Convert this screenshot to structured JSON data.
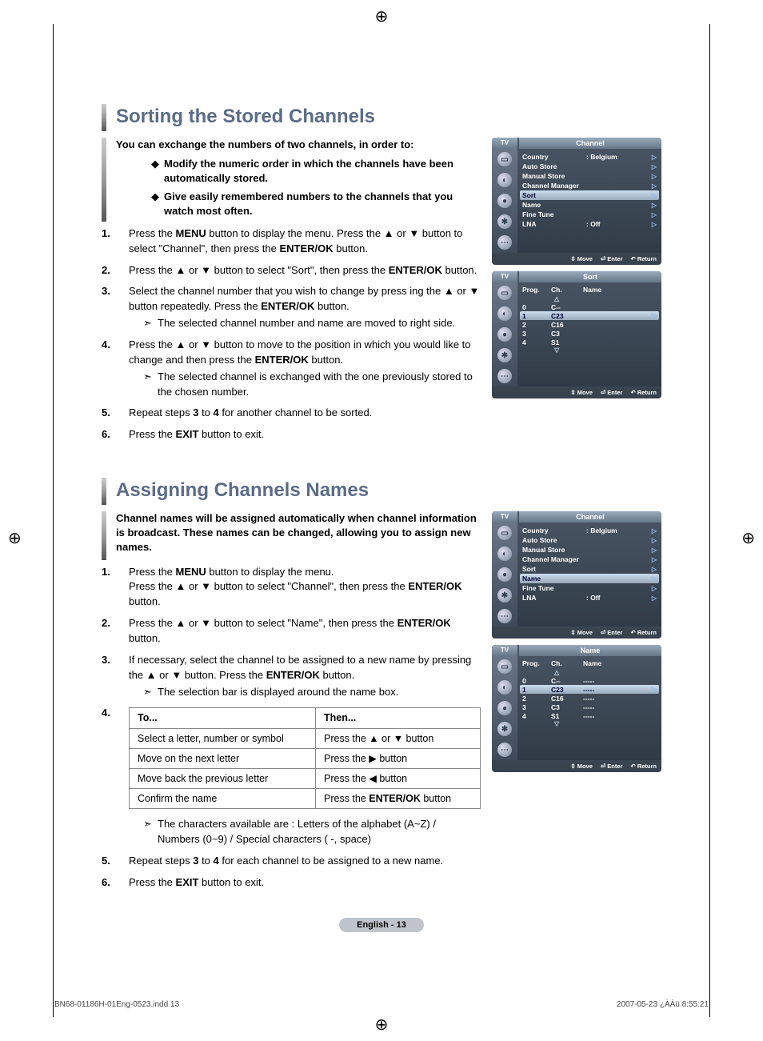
{
  "reg_glyph": "⊕",
  "section1": {
    "title": "Sorting the Stored Channels",
    "lead": "You can exchange the numbers of two channels, in order to:",
    "bullets": [
      "Modify the numeric order in which the channels have been automatically stored.",
      "Give easily remembered numbers to the channels that you watch most often."
    ],
    "steps": {
      "s1_a": "Press the ",
      "s1_menu": "MENU",
      "s1_b": " button to display the menu.  Press the ▲ or ▼ button to select \"Channel\", then press the ",
      "s1_enter": "ENTER/OK",
      "s1_c": " button.",
      "s2_a": "Press the ▲ or ▼ button to select \"Sort\", then press the ",
      "s2_enter": "ENTER/OK",
      "s2_b": " button.",
      "s3_a": "Select the channel number that you wish to change by press ing the ▲ or ▼ button repeatedly. Press the ",
      "s3_enter": "ENTER/OK",
      "s3_b": " button.",
      "s3_sub": "The selected channel number and name are moved to right side.",
      "s4_a": "Press the ▲ or ▼ button to move to the position in which you would like to change and then press the  ",
      "s4_enter": "ENTER/OK",
      "s4_b": " button.",
      "s4_sub": "The selected channel is exchanged with the one previously stored to the chosen number.",
      "s5_a": "Repeat steps ",
      "s5_b": "3",
      "s5_c": " to ",
      "s5_d": "4",
      "s5_e": " for another channel to be sorted.",
      "s6_a": "Press the ",
      "s6_exit": "EXIT",
      "s6_b": " button to exit."
    }
  },
  "section2": {
    "title": "Assigning Channels Names",
    "lead": "Channel names will be assigned automatically when channel information is broadcast. These names can be changed, allowing you to assign new names.",
    "steps": {
      "s1_a": "Press the ",
      "s1_menu": "MENU",
      "s1_b": " button to display the menu.",
      "s1_c": "Press the ▲ or ▼ button to select \"Channel\", then press the ",
      "s1_enter": "ENTER/OK",
      "s1_d": " button.",
      "s2_a": "Press the ▲ or ▼ button to select \"Name\", then press the ",
      "s2_enter": "ENTER/OK",
      "s2_b": " button.",
      "s3_a": "If necessary, select the channel to be assigned to a new name by pressing the ▲ or ▼ button. Press the ",
      "s3_enter": "ENTER/OK",
      "s3_b": " button.",
      "s3_sub": "The selection bar is displayed around the name box.",
      "s4_note_a": "The characters available are : Letters of the alphabet (A~Z) / Numbers (0~9) / Special characters ( -, space)",
      "s5_a": "Repeat steps ",
      "s5_b": "3",
      "s5_c": " to ",
      "s5_d": "4",
      "s5_e": " for each channel to be assigned to a new name.",
      "s6_a": "Press the ",
      "s6_exit": "EXIT",
      "s6_b": " button to exit."
    },
    "table": {
      "h1": "To...",
      "h2": "Then...",
      "rows": [
        {
          "a": "Select a letter, number or symbol",
          "b": "Press the ▲ or ▼ button"
        },
        {
          "a": "Move on the next letter",
          "b": "Press the ▶ button"
        },
        {
          "a": "Move back the previous letter",
          "b": "Press the ◀ button"
        },
        {
          "a": "Confirm the name",
          "b_pre": "Press the ",
          "b_bold": "ENTER/OK",
          "b_post": " button"
        }
      ]
    }
  },
  "osd": {
    "tv": "TV",
    "channel_title": "Channel",
    "sort_title": "Sort",
    "name_title": "Name",
    "menu": {
      "country": "Country",
      "country_val": ": Belgium",
      "auto_store": "Auto Store",
      "manual_store": "Manual Store",
      "channel_manager": "Channel Manager",
      "sort": "Sort",
      "name": "Name",
      "fine_tune": "Fine Tune",
      "lna": "LNA",
      "lna_val": ": Off"
    },
    "cols": {
      "prog": "Prog.",
      "ch": "Ch.",
      "name": "Name"
    },
    "sort_rows": [
      {
        "p": "0",
        "c": "C--",
        "n": ""
      },
      {
        "p": "1",
        "c": "C23",
        "n": "",
        "hl": true
      },
      {
        "p": "2",
        "c": "C16",
        "n": ""
      },
      {
        "p": "3",
        "c": "C3",
        "n": ""
      },
      {
        "p": "4",
        "c": "S1",
        "n": ""
      }
    ],
    "name_rows": [
      {
        "p": "0",
        "c": "C--",
        "n": "-----"
      },
      {
        "p": "1",
        "c": "C23",
        "n": "-----",
        "hl": true
      },
      {
        "p": "2",
        "c": "C16",
        "n": "-----"
      },
      {
        "p": "3",
        "c": "C3",
        "n": "-----"
      },
      {
        "p": "4",
        "c": "S1",
        "n": "-----"
      }
    ],
    "footer": {
      "move": "Move",
      "enter": "Enter",
      "return": "Return"
    }
  },
  "page_num": "English - 13",
  "footer": {
    "left": "BN68-01186H-01Eng-0523.indd   13",
    "right": "2007-05-23   ¿ÀÀü 8:55:21"
  },
  "glyphs": {
    "diamond": "◆",
    "sub_arrow": "➣",
    "tri_r": "▷",
    "tri_up": "△",
    "tri_dn": "▽",
    "move_ic": "⇳",
    "enter_ic": "⏎",
    "return_ic": "↶"
  }
}
